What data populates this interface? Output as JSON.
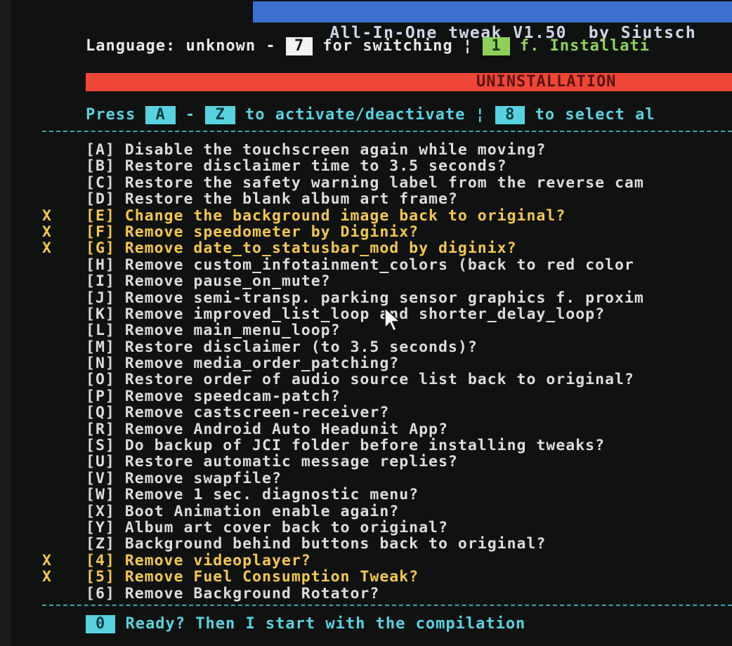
{
  "window": {
    "title": "All-In-One tweak V1.50  by Siutsch"
  },
  "language": {
    "label": "Language: unknown -",
    "switch_key": "7",
    "switch_text": "for switching",
    "separator": "¦",
    "install_key": "1",
    "install_text": "f. Installati"
  },
  "mode_banner": "UNINSTALLATION",
  "press": {
    "prefix": "Press",
    "key_from": "A",
    "dash": "-",
    "key_to": "Z",
    "text": "to activate/deactivate",
    "separator": "¦",
    "select_key": "8",
    "select_text": "to select al"
  },
  "options": [
    {
      "mark": "",
      "text": "[A] Disable the touchscreen again while moving?",
      "selected": false
    },
    {
      "mark": "",
      "text": "[B] Restore disclaimer time to 3.5 seconds?",
      "selected": false
    },
    {
      "mark": "",
      "text": "[C] Restore the safety warning label from the reverse cam",
      "selected": false
    },
    {
      "mark": "",
      "text": "[D] Restore the blank album art frame?",
      "selected": false
    },
    {
      "mark": "X",
      "text": "[E] Change the background image back to original?",
      "selected": true
    },
    {
      "mark": "X",
      "text": "[F] Remove speedometer by Diginix?",
      "selected": true
    },
    {
      "mark": "X",
      "text": "[G] Remove date_to_statusbar_mod by diginix?",
      "selected": true
    },
    {
      "mark": "",
      "text": "[H] Remove custom_infotainment_colors (back to red color",
      "selected": false
    },
    {
      "mark": "",
      "text": "[I] Remove pause_on_mute?",
      "selected": false
    },
    {
      "mark": "",
      "text": "[J] Remove semi-transp. parking sensor graphics f. proxim",
      "selected": false
    },
    {
      "mark": "",
      "text": "[K] Remove improved_list_loop and shorter_delay_loop?",
      "selected": false
    },
    {
      "mark": "",
      "text": "[L] Remove main_menu_loop?",
      "selected": false
    },
    {
      "mark": "",
      "text": "[M] Restore disclaimer (to 3.5 seconds)?",
      "selected": false
    },
    {
      "mark": "",
      "text": "[N] Remove media_order_patching?",
      "selected": false
    },
    {
      "mark": "",
      "text": "[O] Restore order of audio source list back to original?",
      "selected": false
    },
    {
      "mark": "",
      "text": "[P] Remove speedcam-patch?",
      "selected": false
    },
    {
      "mark": "",
      "text": "[Q] Remove castscreen-receiver?",
      "selected": false
    },
    {
      "mark": "",
      "text": "[R] Remove Android Auto Headunit App?",
      "selected": false
    },
    {
      "mark": "",
      "text": "[S] Do backup of JCI folder before installing tweaks?",
      "selected": false
    },
    {
      "mark": "",
      "text": "[U] Restore automatic message replies?",
      "selected": false
    },
    {
      "mark": "",
      "text": "[V] Remove swapfile?",
      "selected": false
    },
    {
      "mark": "",
      "text": "[W] Remove 1 sec. diagnostic menu?",
      "selected": false
    },
    {
      "mark": "",
      "text": "[X] Boot Animation enable again?",
      "selected": false
    },
    {
      "mark": "",
      "text": "[Y] Album art cover back to original?",
      "selected": false
    },
    {
      "mark": "",
      "text": "[Z] Background behind buttons back to original?",
      "selected": false
    },
    {
      "mark": "X",
      "text": "[4] Remove videoplayer?",
      "selected": true
    },
    {
      "mark": "X",
      "text": "[5] Remove Fuel Consumption Tweak?",
      "selected": true
    },
    {
      "mark": "",
      "text": "[6] Remove Background Rotator?",
      "selected": false
    }
  ],
  "ready": {
    "key": "0",
    "text": "Ready? Then I start with the compilation"
  },
  "colors": {
    "title_bar": "#3b6fd0",
    "banner": "#ee4637",
    "cyan": "#57d3e0",
    "selected": "#f3c84a",
    "green": "#8fd05a"
  },
  "icons": {
    "mouse_cursor": "arrow-cursor-icon"
  }
}
